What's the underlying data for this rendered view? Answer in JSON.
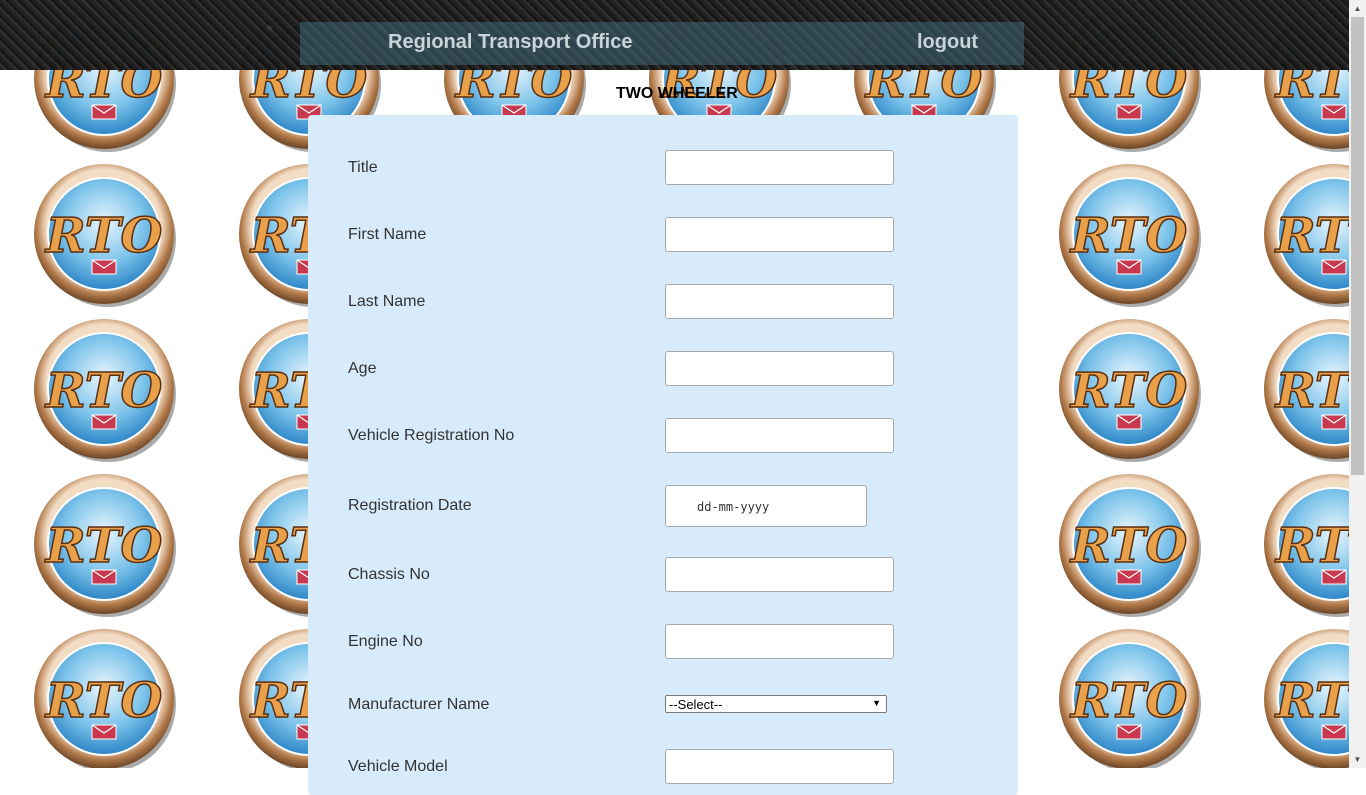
{
  "header": {
    "title": "Regional Transport Office",
    "logout_label": "logout"
  },
  "logo_text": "RTO",
  "form": {
    "heading": "TWO WHEELER",
    "fields": [
      {
        "label": "Title",
        "type": "text",
        "value": ""
      },
      {
        "label": "First Name",
        "type": "text",
        "value": ""
      },
      {
        "label": "Last Name",
        "type": "text",
        "value": ""
      },
      {
        "label": "Age",
        "type": "text",
        "value": ""
      },
      {
        "label": "Vehicle Registration No",
        "type": "text",
        "value": ""
      },
      {
        "label": "Registration Date",
        "type": "date",
        "placeholder": "dd-mm-yyyy"
      },
      {
        "label": "Chassis No",
        "type": "text",
        "value": ""
      },
      {
        "label": "Engine No",
        "type": "text",
        "value": ""
      },
      {
        "label": "Manufacturer Name",
        "type": "select",
        "selected": "--Select--"
      },
      {
        "label": "Vehicle Model",
        "type": "text",
        "value": ""
      }
    ]
  },
  "colors": {
    "panel": "#d7ebfb",
    "header_text": "#c9d4da"
  }
}
